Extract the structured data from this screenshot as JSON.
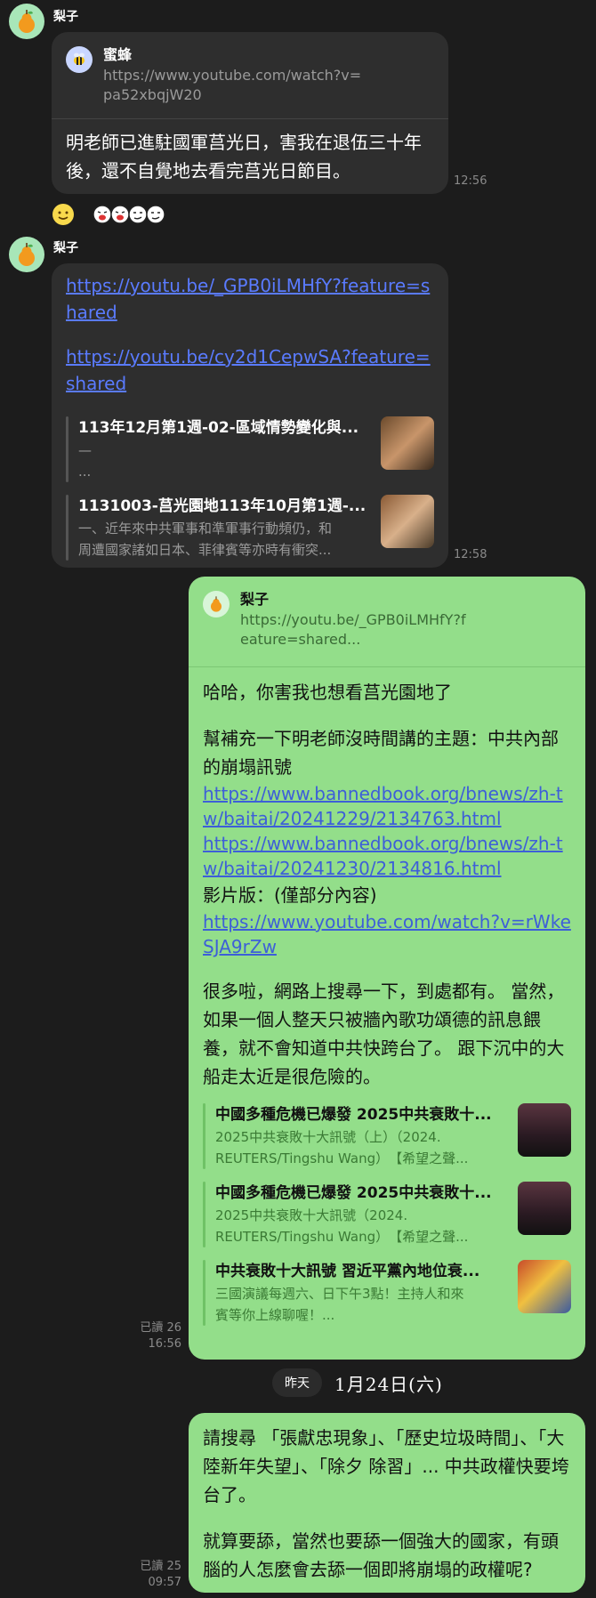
{
  "msg1": {
    "sender": "梨子",
    "reply_name": "蜜蜂",
    "reply_link": "https://www.youtube.com/watch?v=pa52xbqjW20",
    "text": "明老師已進駐國軍莒光日，害我在退伍三十年後，還不自覺地去看完莒光日節目。",
    "time": "12:56"
  },
  "msg2": {
    "sender": "梨子",
    "link1": "https://youtu.be/_GPB0iLMHfY?feature=shared",
    "link2": "https://youtu.be/cy2d1CepwSA?feature=shared",
    "previews": [
      {
        "title": "113年12月第1週-02-區域情勢變化與...",
        "desc1": "—",
        "desc2": "..."
      },
      {
        "title": "1131003-莒光園地113年10月第1週-...",
        "desc1": "一、近年來中共軍事和準軍事行動頻仍，和",
        "desc2": "周遭國家諸如日本、菲律賓等亦時有衝突..."
      }
    ],
    "time": "12:58"
  },
  "msg3": {
    "reply_name": "梨子",
    "reply_link": "https://youtu.be/_GPB0iLMHfY?feature=shared...",
    "line1": "哈哈，你害我也想看莒光園地了",
    "line2": "幫補充一下明老師沒時間講的主題：中共內部的崩塌訊號",
    "link1": "https://www.bannedbook.org/bnews/zh-tw/baitai/20241229/2134763.html",
    "link2": "https://www.bannedbook.org/bnews/zh-tw/baitai/20241230/2134816.html",
    "line3": "影片版：(僅部分內容)",
    "link3": "https://www.youtube.com/watch?v=rWkeSJA9rZw",
    "line4": "很多啦，網路上搜尋一下，到處都有。 當然，如果一個人整天只被牆內歌功頌德的訊息餵養，就不會知道中共快跨台了。 跟下沉中的大船走太近是很危險的。",
    "previews": [
      {
        "title": "中國多種危機已爆發 2025中共衰敗十...",
        "desc1": "2025中共衰敗十大訊號（上）（2024.",
        "desc2": "REUTERS/Tingshu Wang）　【希望之聲..."
      },
      {
        "title": "中國多種危機已爆發 2025中共衰敗十...",
        "desc1": "2025中共衰敗十大訊號（2024.",
        "desc2": "REUTERS/Tingshu Wang）　【希望之聲..."
      },
      {
        "title": "中共衰敗十大訊號 習近平黨內地位衰...",
        "desc1": "三國演議每週六、日下午3點！主持人和來",
        "desc2": "賓等你上線聊喔！..."
      }
    ],
    "read": "已讀 26",
    "time": "16:56"
  },
  "date_separator": {
    "pill": "昨天",
    "date": "1月24日(六)"
  },
  "msg4": {
    "line1": "請搜尋 「張獻忠現象」、「歷史垃圾時間」、「大陸新年失望」、「除夕 除習」... 中共政權快要垮台了。",
    "line2": "就算要舔，當然也要舔一個強大的國家，有頭腦的人怎麼會去舔一個即將崩塌的政權呢?",
    "read": "已讀 25",
    "time": "09:57"
  },
  "colors": {
    "incoming_bubble": "#2e2e2e",
    "outgoing_bubble": "#93de8a",
    "link_dark": "#5a7bff",
    "link_light": "#3d5fd8",
    "background": "#1c1c1c"
  }
}
